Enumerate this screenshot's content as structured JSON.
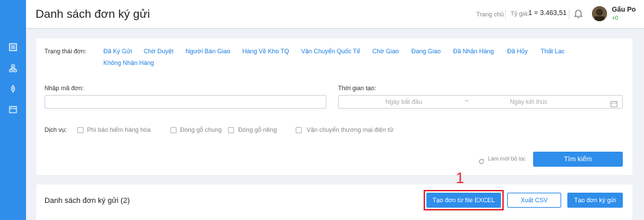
{
  "header": {
    "title": "Danh sách đơn ký gửi",
    "home_link": "Trang chủ",
    "rate_label": "Tỷ giá:",
    "rate_value": "1 = 3.463,51",
    "user_name": "Gấu Po",
    "user_balance": "+0"
  },
  "sidebar": {
    "items": [
      {
        "icon": "list-icon"
      },
      {
        "icon": "network-icon"
      },
      {
        "icon": "rocket-icon"
      },
      {
        "icon": "calendar-icon"
      }
    ]
  },
  "filters": {
    "status_label": "Trạng thái đơn:",
    "statuses": [
      "Đã Ký Gửi",
      "Chờ Duyệt",
      "Người Bán Giao",
      "Hàng Về Kho TQ",
      "Vận Chuyển Quốc Tế",
      "Chờ Giao",
      "Đang Giao",
      "Đã Nhận Hàng",
      "Đã Hủy",
      "Thất Lạc",
      "Không Nhận Hàng"
    ],
    "order_code_label": "Nhập mã đơn:",
    "order_code_value": "",
    "time_label": "Thời gian tạo:",
    "start_date_placeholder": "Ngày bắt đầu",
    "date_separator": "~",
    "end_date_placeholder": "Ngày kết thúc",
    "service_label": "Dịch vụ:",
    "services": [
      {
        "label": "Phí bảo hiểm hàng hóa",
        "checked": false
      },
      {
        "label": "Đóng gỗ chung",
        "checked": false
      },
      {
        "label": "Đóng gỗ riêng",
        "checked": false
      },
      {
        "label": "Vận chuyển thương mại điện tử",
        "checked": false
      }
    ],
    "reset_label": "Làm mới bộ lọc",
    "search_label": "Tìm kiếm"
  },
  "list": {
    "title": "Danh sách đơn ký gửi (2)",
    "excel_button": "Tạo đơn từ file EXCEL",
    "csv_button": "Xuất CSV",
    "create_button": "Tạo đơn ký gửi",
    "step_marker": "1"
  },
  "colors": {
    "primary": "#2f8eea",
    "link": "#1a7fe0",
    "highlight": "#e0232a",
    "balance": "#2ba84a"
  }
}
